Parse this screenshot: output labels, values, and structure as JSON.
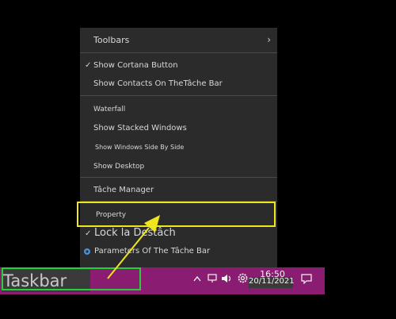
{
  "menu": {
    "items": [
      {
        "label": "Toolbars",
        "checked": false,
        "submenu": true
      },
      {
        "label": "Show Cortana Button",
        "checked": true
      },
      {
        "label": "Show Contacts On TheTâche Bar",
        "checked": false
      },
      {
        "label": "Waterfall",
        "checked": false
      },
      {
        "label": "Show Stacked Windows",
        "checked": false
      },
      {
        "label": "Show Windows Side By Side",
        "checked": false
      },
      {
        "label": "Show Desktop",
        "checked": false
      },
      {
        "label": "Tâche Manager",
        "checked": false
      },
      {
        "label": "Property",
        "checked": false
      },
      {
        "label": "Lock la Destâch",
        "checked": true
      },
      {
        "label": "Parameters Of The Tâche Bar",
        "checked": false
      }
    ],
    "check_glyph": "✓",
    "submenu_glyph": "›"
  },
  "taskbar": {
    "label": "Taskbar",
    "time": "16:50",
    "date": "20/11/2021",
    "color": "#8a1d72"
  },
  "annotations": {
    "highlight_yellow": "#f0e61e",
    "highlight_green": "#26d138"
  }
}
